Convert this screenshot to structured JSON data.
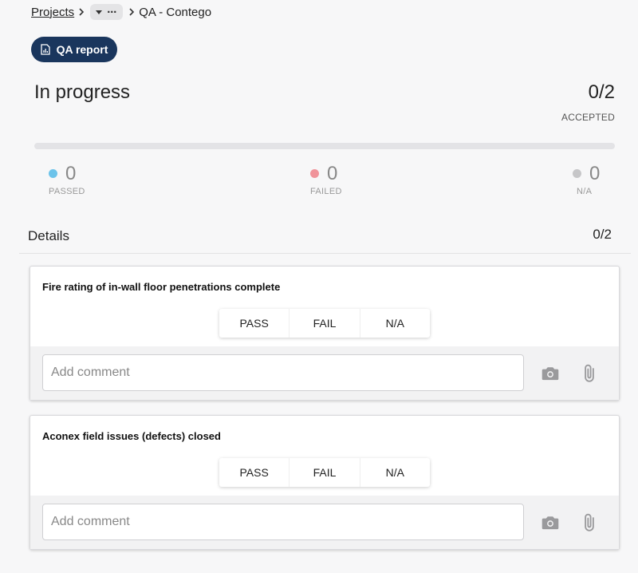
{
  "breadcrumb": {
    "root": "Projects",
    "current": "QA - Contego"
  },
  "toolbar": {
    "report_label": "QA report"
  },
  "summary": {
    "status": "In progress",
    "ratio": "0/2",
    "ratio_label": "ACCEPTED",
    "progress_fraction": 0,
    "passed": {
      "count": "0",
      "label": "PASSED",
      "color": "#6cc3ea"
    },
    "failed": {
      "count": "0",
      "label": "FAILED",
      "color": "#f0939a"
    },
    "na": {
      "count": "0",
      "label": "N/A",
      "color": "#c6c6c8"
    }
  },
  "details": {
    "title": "Details",
    "count": "0/2",
    "items": [
      {
        "title": "Fire rating of in-wall floor penetrations complete",
        "pass": "PASS",
        "fail": "FAIL",
        "na": "N/A",
        "comment_placeholder": "Add comment"
      },
      {
        "title": "Aconex field issues (defects) closed",
        "pass": "PASS",
        "fail": "FAIL",
        "na": "N/A",
        "comment_placeholder": "Add comment"
      }
    ]
  }
}
